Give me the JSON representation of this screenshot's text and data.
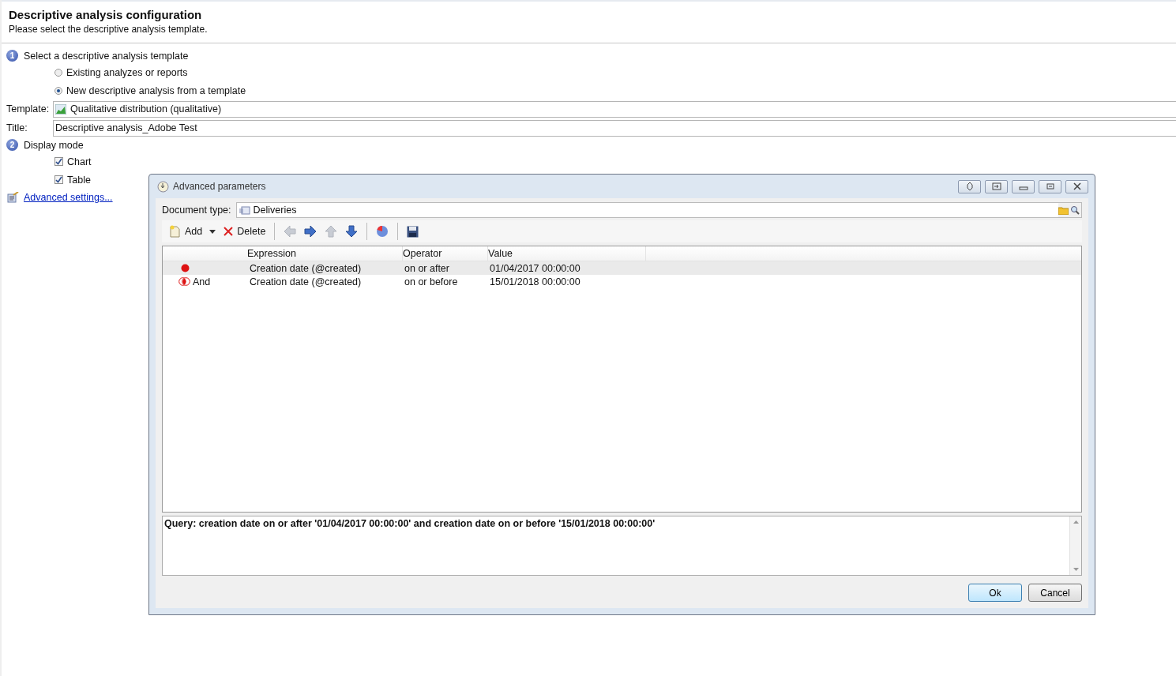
{
  "header": {
    "title": "Descriptive analysis configuration",
    "subtitle": "Please select the descriptive analysis template."
  },
  "step1": {
    "number": "1",
    "label": "Select a descriptive analysis template",
    "options": [
      {
        "label": "Existing analyzes or reports",
        "selected": false
      },
      {
        "label": "New descriptive analysis from a template",
        "selected": true
      }
    ]
  },
  "template": {
    "label": "Template:",
    "value": "Qualitative distribution (qualitative)"
  },
  "title_field": {
    "label": "Title:",
    "value": "Descriptive analysis_Adobe Test"
  },
  "step2": {
    "number": "2",
    "label": "Display mode",
    "options": [
      {
        "label": "Chart",
        "checked": true
      },
      {
        "label": "Table",
        "checked": true
      }
    ]
  },
  "advanced_link": "Advanced settings...",
  "dialog": {
    "title": "Advanced parameters",
    "document_type": {
      "label": "Document type:",
      "value": "Deliveries"
    },
    "toolbar": [
      {
        "kind": "add",
        "label": "Add",
        "disabled": false
      },
      {
        "kind": "delete",
        "label": "Delete",
        "disabled": false
      },
      {
        "kind": "sep"
      },
      {
        "kind": "left",
        "disabled": true
      },
      {
        "kind": "right",
        "disabled": false
      },
      {
        "kind": "up",
        "disabled": true
      },
      {
        "kind": "down",
        "disabled": false
      },
      {
        "kind": "sep"
      },
      {
        "kind": "pie",
        "disabled": false
      },
      {
        "kind": "sep"
      },
      {
        "kind": "save",
        "disabled": false
      }
    ],
    "columns": [
      "Expression",
      "Operator",
      "Value"
    ],
    "rows": [
      {
        "kind": "condition",
        "logic": "",
        "expression": "Creation date (@created)",
        "operator": "on or after",
        "value": "01/04/2017 00:00:00",
        "selected": true
      },
      {
        "kind": "and",
        "logic": "And",
        "expression": "Creation date (@created)",
        "operator": "on or before",
        "value": "15/01/2018 00:00:00",
        "selected": false
      }
    ],
    "query": "Query: creation date on or after '01/04/2017 00:00:00' and creation date on or before '15/01/2018 00:00:00'",
    "buttons": [
      {
        "label": "Ok",
        "default": true
      },
      {
        "label": "Cancel",
        "default": false
      }
    ]
  }
}
